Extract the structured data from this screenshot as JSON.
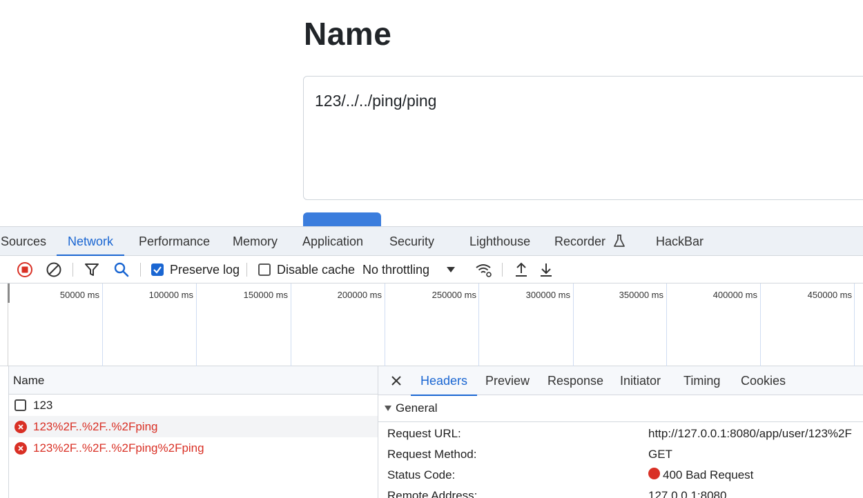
{
  "page": {
    "title": "Name",
    "textarea_value": "123/../../ping/ping",
    "submit_label": ""
  },
  "devtools": {
    "panel_tabs": [
      {
        "label": "Sources",
        "active": false
      },
      {
        "label": "Network",
        "active": true
      },
      {
        "label": "Performance",
        "active": false
      },
      {
        "label": "Memory",
        "active": false
      },
      {
        "label": "Application",
        "active": false
      },
      {
        "label": "Security",
        "active": false
      },
      {
        "label": "Lighthouse",
        "active": false
      },
      {
        "label": "Recorder",
        "active": false,
        "icon": "flask-icon"
      },
      {
        "label": "HackBar",
        "active": false
      }
    ],
    "toolbar": {
      "preserve_log_label": "Preserve log",
      "preserve_log_checked": true,
      "disable_cache_label": "Disable cache",
      "disable_cache_checked": false,
      "throttling_value": "No throttling",
      "icons": [
        "stop-recording-icon",
        "clear-icon",
        "filter-icon",
        "search-icon",
        "network-conditions-icon",
        "import-har-icon",
        "export-har-icon"
      ]
    },
    "overview": {
      "ticks": [
        "50000 ms",
        "100000 ms",
        "150000 ms",
        "200000 ms",
        "250000 ms",
        "300000 ms",
        "350000 ms",
        "400000 ms",
        "450000 ms"
      ]
    },
    "request_list": {
      "column_header": "Name",
      "rows": [
        {
          "name": "123",
          "status": "ok"
        },
        {
          "name": "123%2F..%2F..%2Fping",
          "status": "error"
        },
        {
          "name": "123%2F..%2F..%2Fping%2Fping",
          "status": "error"
        }
      ]
    },
    "details": {
      "tabs": [
        {
          "label": "Headers",
          "active": true
        },
        {
          "label": "Preview",
          "active": false
        },
        {
          "label": "Response",
          "active": false
        },
        {
          "label": "Initiator",
          "active": false
        },
        {
          "label": "Timing",
          "active": false
        },
        {
          "label": "Cookies",
          "active": false
        }
      ],
      "section_title": "General",
      "rows": [
        {
          "key": "Request URL:",
          "value": "http://127.0.0.1:8080/app/user/123%2F"
        },
        {
          "key": "Request Method:",
          "value": "GET"
        },
        {
          "key": "Status Code:",
          "value": "400 Bad Request"
        },
        {
          "key": "Remote Address:",
          "value": "127.0.0.1:8080"
        }
      ],
      "status_color": "#d93025"
    },
    "colors": {
      "accent": "#1a66d2",
      "error": "#d93025",
      "tab_bar_bg": "#edf1f6"
    }
  }
}
